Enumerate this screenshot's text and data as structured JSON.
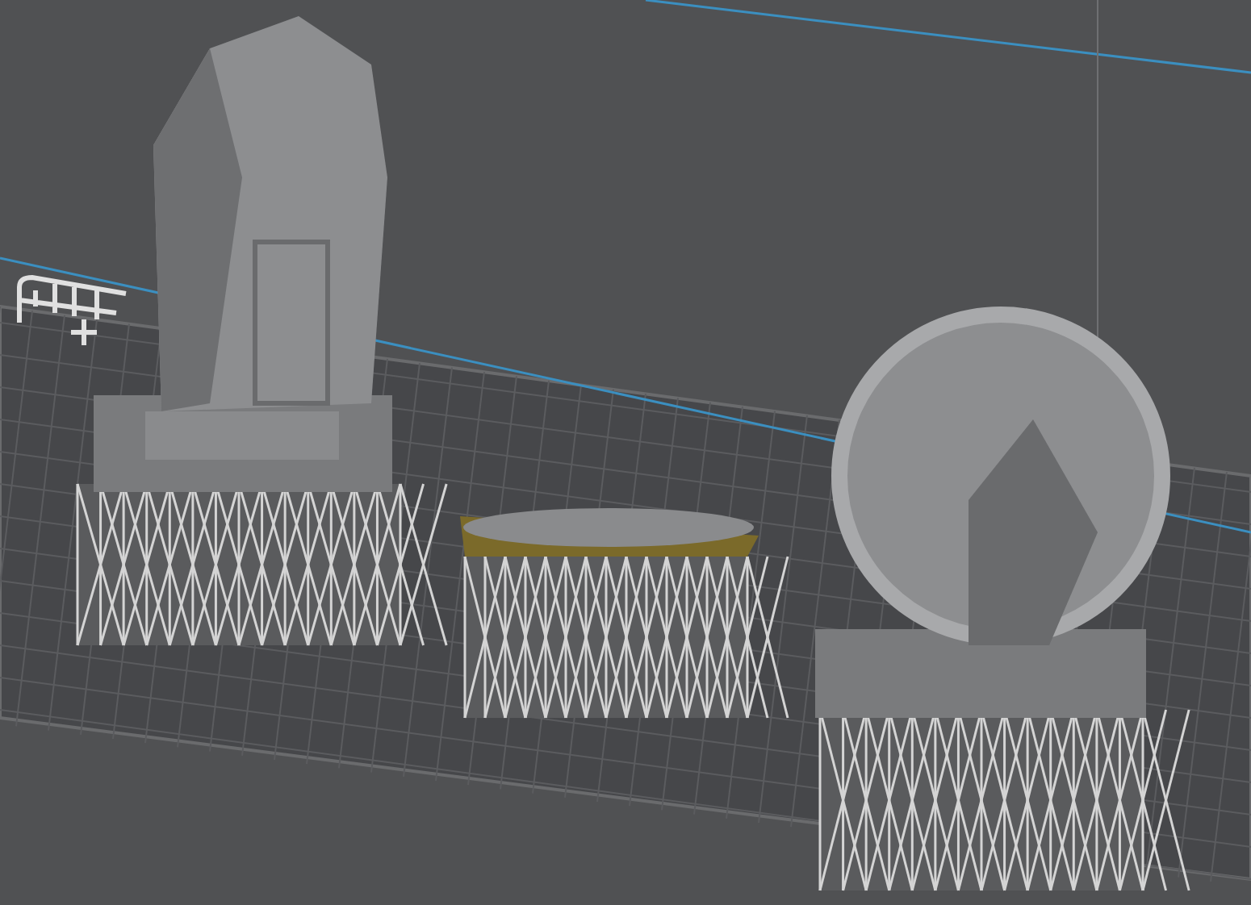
{
  "viewport": {
    "models": [
      {
        "kind": "crystal-tower"
      },
      {
        "kind": "support-ring"
      },
      {
        "kind": "orb-tower"
      }
    ]
  }
}
